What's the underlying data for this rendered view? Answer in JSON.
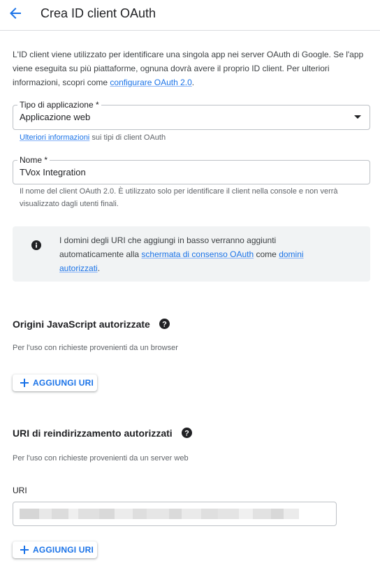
{
  "header": {
    "title": "Crea ID client OAuth",
    "back_icon": "arrow-back-icon"
  },
  "intro": {
    "text_before": "L'ID client viene utilizzato per identificare una singola app nei server OAuth di Google. Se l'app viene eseguita su più piattaforme, ognuna dovrà avere il proprio ID client. Per ulteriori informazioni, scopri come ",
    "link": "configurare OAuth 2.0",
    "text_after": "."
  },
  "app_type": {
    "label": "Tipo di applicazione *",
    "value": "Applicazione web",
    "hint_link": "Ulteriori informazioni",
    "hint_text": " sui tipi di client OAuth"
  },
  "name": {
    "label": "Nome *",
    "value": "TVox Integration",
    "hint": "Il nome del client OAuth 2.0. È utilizzato solo per identificare il client nella console e non verrà visualizzato dagli utenti finali."
  },
  "info": {
    "icon": "info-icon",
    "text_1": "I domini degli URI che aggiungi in basso verranno aggiunti automaticamente alla ",
    "link_1": "schermata di consenso OAuth",
    "text_2": " come ",
    "link_2": "domini autorizzati",
    "text_3": "."
  },
  "js_origins": {
    "title": "Origini JavaScript autorizzate",
    "description": "Per l'uso con richieste provenienti da un browser",
    "add_button": "AGGIUNGI URI"
  },
  "redirect_uris": {
    "title": "URI di reindirizzamento autorizzati",
    "description": "Per l'uso con richieste provenienti da un server web",
    "uri_label": "URI",
    "uri_value_state": "blurred",
    "add_button": "AGGIUNGI URI"
  },
  "colors": {
    "accent": "#1a73e8",
    "text": "#202124",
    "secondary_text": "#5f6368",
    "info_background": "#f1f3f4"
  }
}
